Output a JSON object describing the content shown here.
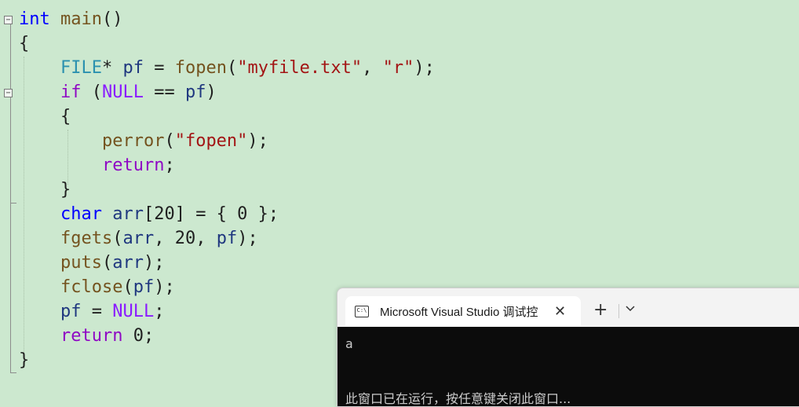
{
  "theme": {
    "editor_bg": "#cce8cf",
    "keyword": "#0000ff",
    "function": "#74531f",
    "string": "#a31515",
    "variable": "#1f377f",
    "type": "#2b91af",
    "control": "#8f08c4",
    "macro": "#8a1bff"
  },
  "code": {
    "lines": [
      [
        {
          "t": "int",
          "c": "kw"
        },
        {
          "t": " ",
          "c": "pn"
        },
        {
          "t": "main",
          "c": "fn"
        },
        {
          "t": "()",
          "c": "pn"
        }
      ],
      [
        {
          "t": "{",
          "c": "pn"
        }
      ],
      [
        {
          "t": "    ",
          "c": "pn"
        },
        {
          "t": "FILE",
          "c": "type"
        },
        {
          "t": "* ",
          "c": "pn"
        },
        {
          "t": "pf",
          "c": "var"
        },
        {
          "t": " = ",
          "c": "pn"
        },
        {
          "t": "fopen",
          "c": "fn"
        },
        {
          "t": "(",
          "c": "pn"
        },
        {
          "t": "\"myfile.txt\"",
          "c": "str"
        },
        {
          "t": ", ",
          "c": "pn"
        },
        {
          "t": "\"r\"",
          "c": "str"
        },
        {
          "t": ");",
          "c": "pn"
        }
      ],
      [
        {
          "t": "    ",
          "c": "pn"
        },
        {
          "t": "if",
          "c": "ctl"
        },
        {
          "t": " (",
          "c": "pn"
        },
        {
          "t": "NULL",
          "c": "mac"
        },
        {
          "t": " == ",
          "c": "pn"
        },
        {
          "t": "pf",
          "c": "var"
        },
        {
          "t": ")",
          "c": "pn"
        }
      ],
      [
        {
          "t": "    {",
          "c": "pn"
        }
      ],
      [
        {
          "t": "        ",
          "c": "pn"
        },
        {
          "t": "perror",
          "c": "fn"
        },
        {
          "t": "(",
          "c": "pn"
        },
        {
          "t": "\"fopen\"",
          "c": "str"
        },
        {
          "t": ");",
          "c": "pn"
        }
      ],
      [
        {
          "t": "        ",
          "c": "pn"
        },
        {
          "t": "return",
          "c": "ctl"
        },
        {
          "t": ";",
          "c": "pn"
        }
      ],
      [
        {
          "t": "    }",
          "c": "pn"
        }
      ],
      [
        {
          "t": "    ",
          "c": "pn"
        },
        {
          "t": "char",
          "c": "kw"
        },
        {
          "t": " ",
          "c": "pn"
        },
        {
          "t": "arr",
          "c": "var"
        },
        {
          "t": "[20] = { 0 };",
          "c": "pn"
        }
      ],
      [
        {
          "t": "    ",
          "c": "pn"
        },
        {
          "t": "fgets",
          "c": "fn"
        },
        {
          "t": "(",
          "c": "pn"
        },
        {
          "t": "arr",
          "c": "var"
        },
        {
          "t": ", 20, ",
          "c": "pn"
        },
        {
          "t": "pf",
          "c": "var"
        },
        {
          "t": ");",
          "c": "pn"
        }
      ],
      [
        {
          "t": "    ",
          "c": "pn"
        },
        {
          "t": "puts",
          "c": "fn"
        },
        {
          "t": "(",
          "c": "pn"
        },
        {
          "t": "arr",
          "c": "var"
        },
        {
          "t": ");",
          "c": "pn"
        }
      ],
      [
        {
          "t": "    ",
          "c": "pn"
        },
        {
          "t": "fclose",
          "c": "fn"
        },
        {
          "t": "(",
          "c": "pn"
        },
        {
          "t": "pf",
          "c": "var"
        },
        {
          "t": ");",
          "c": "pn"
        }
      ],
      [
        {
          "t": "    ",
          "c": "pn"
        },
        {
          "t": "pf",
          "c": "var"
        },
        {
          "t": " = ",
          "c": "pn"
        },
        {
          "t": "NULL",
          "c": "mac"
        },
        {
          "t": ";",
          "c": "pn"
        }
      ],
      [
        {
          "t": "    ",
          "c": "pn"
        },
        {
          "t": "return",
          "c": "ctl"
        },
        {
          "t": " 0;",
          "c": "pn"
        }
      ],
      [
        {
          "t": "}",
          "c": "pn"
        }
      ]
    ]
  },
  "terminal": {
    "tab_title": "Microsoft Visual Studio 调试控",
    "tab_icon": "console-icon",
    "close_label": "✕",
    "new_tab_label": "+",
    "output_line1": "a",
    "output_line2": "此窗口已在运行，按任意键关闭此窗口..."
  }
}
